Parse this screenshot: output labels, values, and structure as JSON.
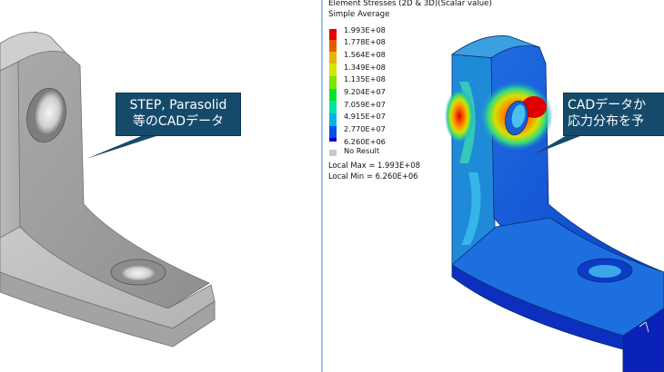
{
  "left_callout": {
    "line1": "STEP, Parasolid",
    "line2": "等のCADデータ",
    "bg_color": "#154a6b"
  },
  "right_callout": {
    "line1": "CADデータか",
    "line2": "応力分布を予",
    "bg_color": "#154a6b"
  },
  "legend": {
    "title_line1": "Element Stresses (2D & 3D)(Scalar value)",
    "title_line2": "Simple Average",
    "levels": [
      {
        "label": "1.993E+08",
        "color": "#e60000"
      },
      {
        "label": "1.778E+08",
        "color": "#e65a00"
      },
      {
        "label": "1.564E+08",
        "color": "#e6b400"
      },
      {
        "label": "1.349E+08",
        "color": "#d2e600"
      },
      {
        "label": "1.135E+08",
        "color": "#78e600"
      },
      {
        "label": "9.204E+07",
        "color": "#00e628"
      },
      {
        "label": "7.059E+07",
        "color": "#00e6a0"
      },
      {
        "label": "4.915E+07",
        "color": "#00b4e6"
      },
      {
        "label": "2.770E+07",
        "color": "#0050e6"
      },
      {
        "label": "6.260E+06",
        "color": "#0000c8"
      }
    ],
    "no_result_label": "No Result",
    "local_max": "Local Max =  1.993E+08",
    "local_min": "Local Min =  6.260E+06"
  }
}
